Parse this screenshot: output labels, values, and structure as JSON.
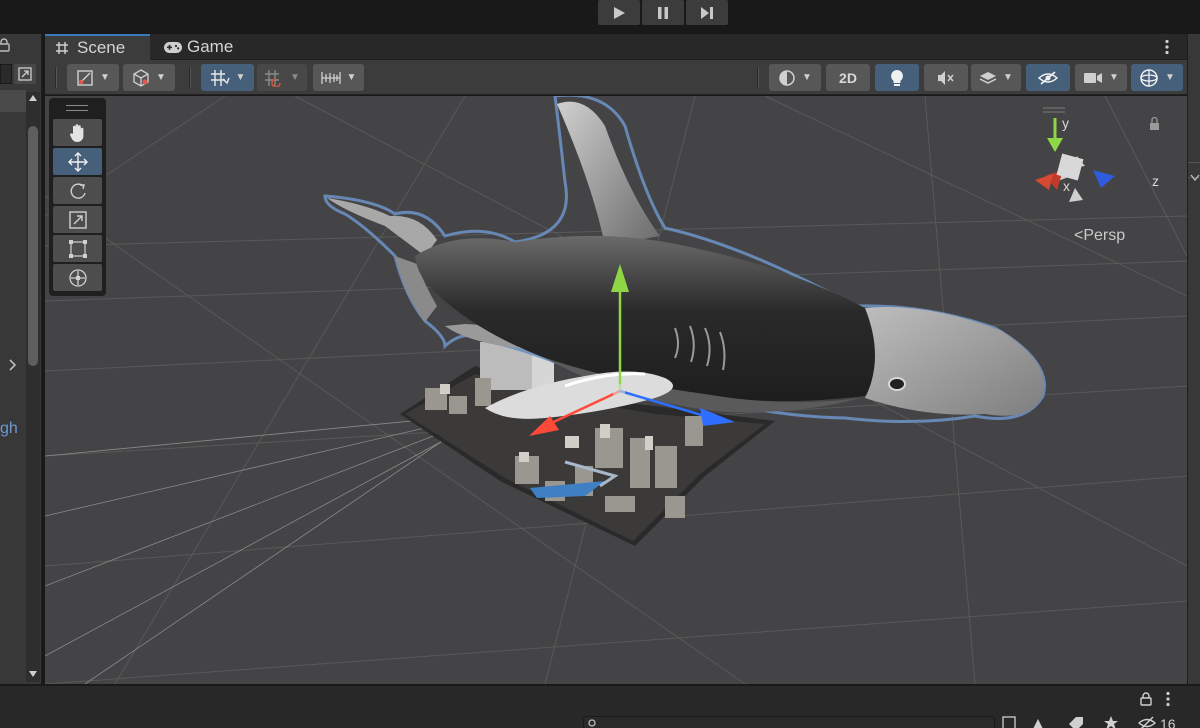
{
  "tabs": {
    "scene": "Scene",
    "game": "Game"
  },
  "toolbar": {
    "mode_2d": "2D"
  },
  "viewport": {
    "projection_label": "Persp",
    "axis_x": "x",
    "axis_y": "y",
    "axis_z": "z"
  },
  "left_panel": {
    "partial_text": "gh"
  },
  "bottom": {
    "count_label": "16"
  },
  "icons": {
    "play": "play-icon",
    "pause": "pause-icon",
    "step": "step-icon",
    "hand": "hand-tool-icon",
    "move": "move-tool-icon",
    "rotate": "rotate-tool-icon",
    "scale": "scale-tool-icon",
    "rect": "rect-tool-icon",
    "transform": "transform-tool-icon"
  },
  "colors": {
    "accent": "#3a79bb",
    "active": "#46607c",
    "viewport": "#444446"
  }
}
